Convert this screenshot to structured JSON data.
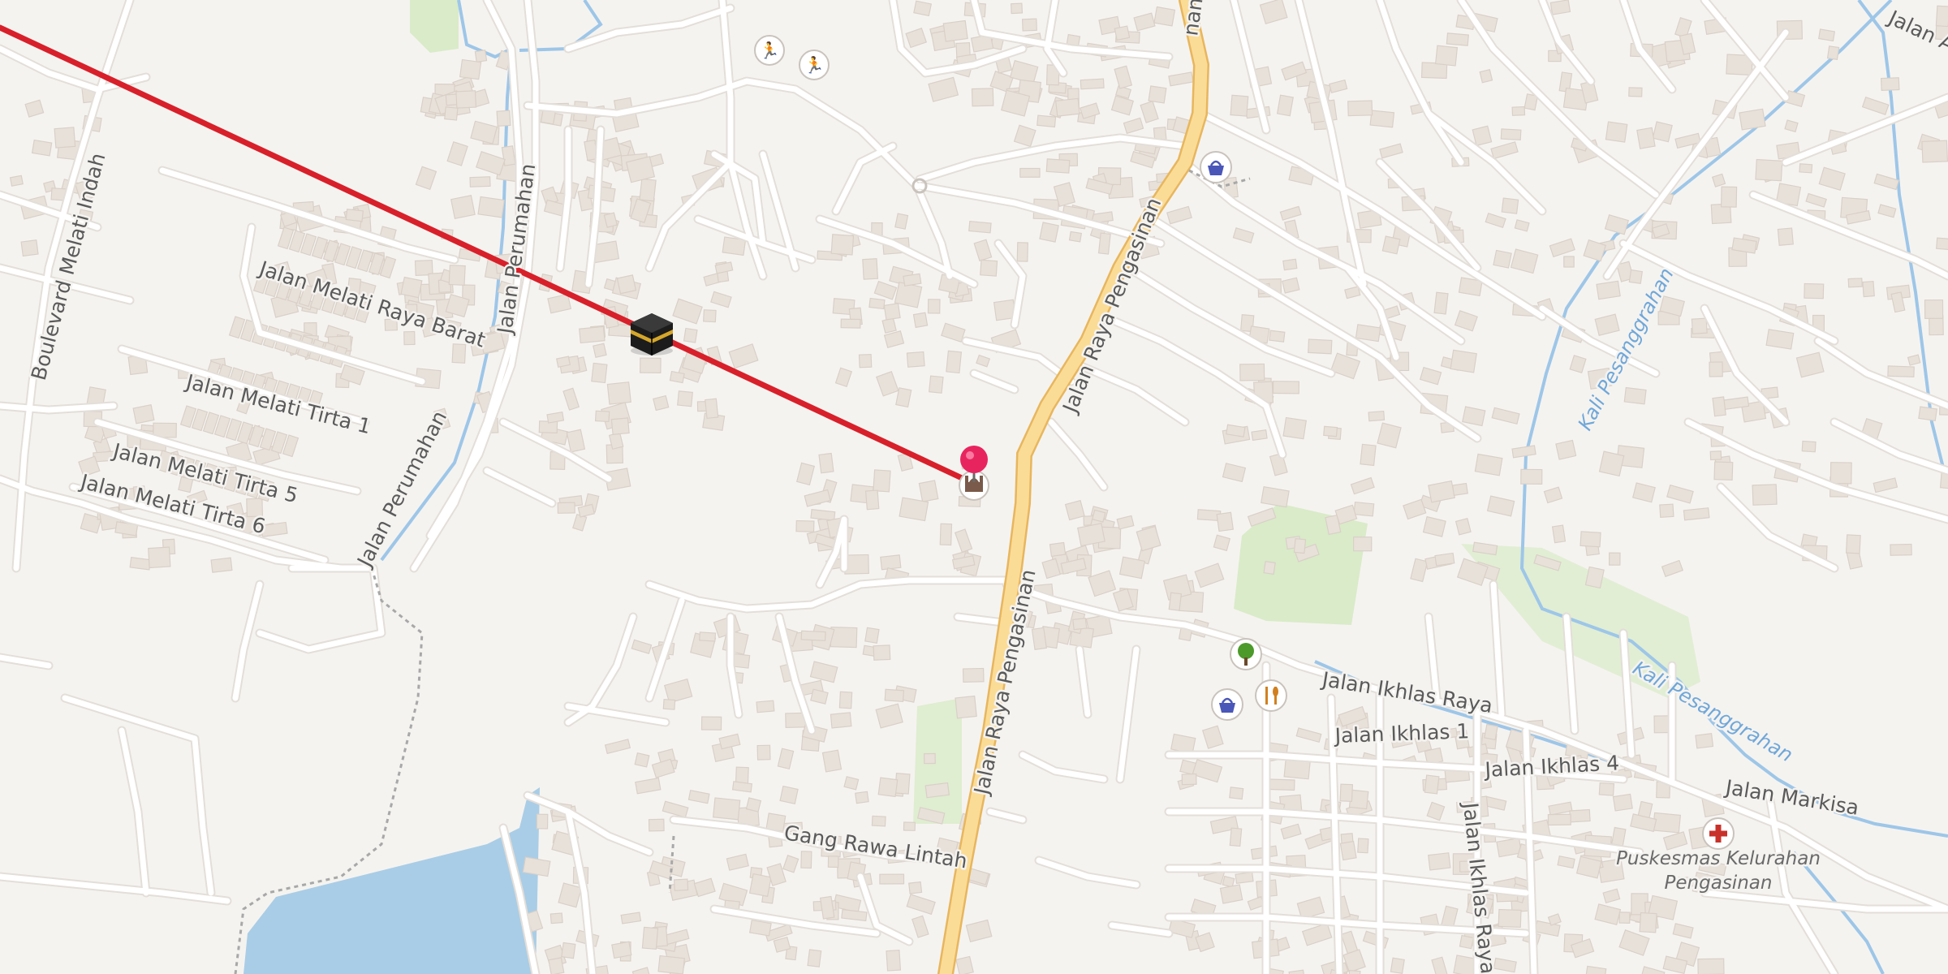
{
  "map": {
    "colors": {
      "background": "#f5f3f0",
      "road": "#ffffff",
      "main_road": "#fbdc96",
      "main_road_casing": "#e7b65e",
      "water": "#a9cde6",
      "waterway": "#8fc0e6",
      "park": "#d6ebc4",
      "building": "#e8e1da",
      "qibla_line": "#d8202a",
      "marker": "#e8245f"
    },
    "qibla_marker": {
      "icon": "kaaba-icon"
    },
    "location_marker": {
      "icon": "map-pin-icon"
    },
    "labels": {
      "jalan_raya_pengasinan_top": "Jalan Raya Pengasinan",
      "jalan_raya_pengasinan_bottom": "Jalan Raya Pengasinan",
      "jalan_raya_pengasinan_partial": "nan",
      "boulevard_melati_indah": "Boulevard Melati Indah",
      "jalan_melati_raya_barat": "Jalan Melati Raya Barat",
      "jalan_perumahan_top": "Jalan Perumahan",
      "jalan_perumahan_bottom": "Jalan Perumahan",
      "jalan_melati_tirta_1": "Jalan Melati Tirta 1",
      "jalan_melati_tirta_5": "Jalan Melati Tirta 5",
      "jalan_melati_tirta_6": "Jalan Melati Tirta 6",
      "jalan_ikhlas_raya": "Jalan Ikhlas Raya",
      "jalan_ikhlas_1": "Jalan Ikhlas 1",
      "jalan_ikhlas_4": "Jalan Ikhlas 4",
      "jalan_ikhlas_raya_vertical": "Jalan Ikhlas Raya",
      "jalan_markisa": "Jalan Markisa",
      "gang_rawa_lintah": "Gang Rawa Lintah",
      "kali_pesanggrahan_1": "Kali Pesanggrahan",
      "kali_pesanggrahan_2": "Kali Pesanggrahan",
      "jalan_a_partial": "Jalan A",
      "puskesmas_line1": "Puskesmas Kelurahan",
      "puskesmas_line2": "Pengasinan"
    },
    "pois": [
      {
        "name": "sports-icon-1",
        "icon": "runner-icon"
      },
      {
        "name": "sports-icon-2",
        "icon": "runner-icon"
      },
      {
        "name": "shop-icon-1",
        "icon": "shopping-basket-icon"
      },
      {
        "name": "shop-icon-2",
        "icon": "shopping-basket-icon"
      },
      {
        "name": "park-icon",
        "icon": "tree-icon"
      },
      {
        "name": "restaurant-icon",
        "icon": "fork-knife-icon"
      },
      {
        "name": "hospital-icon",
        "icon": "red-cross-icon"
      },
      {
        "name": "mosque-icon",
        "icon": "mosque-icon"
      }
    ]
  }
}
